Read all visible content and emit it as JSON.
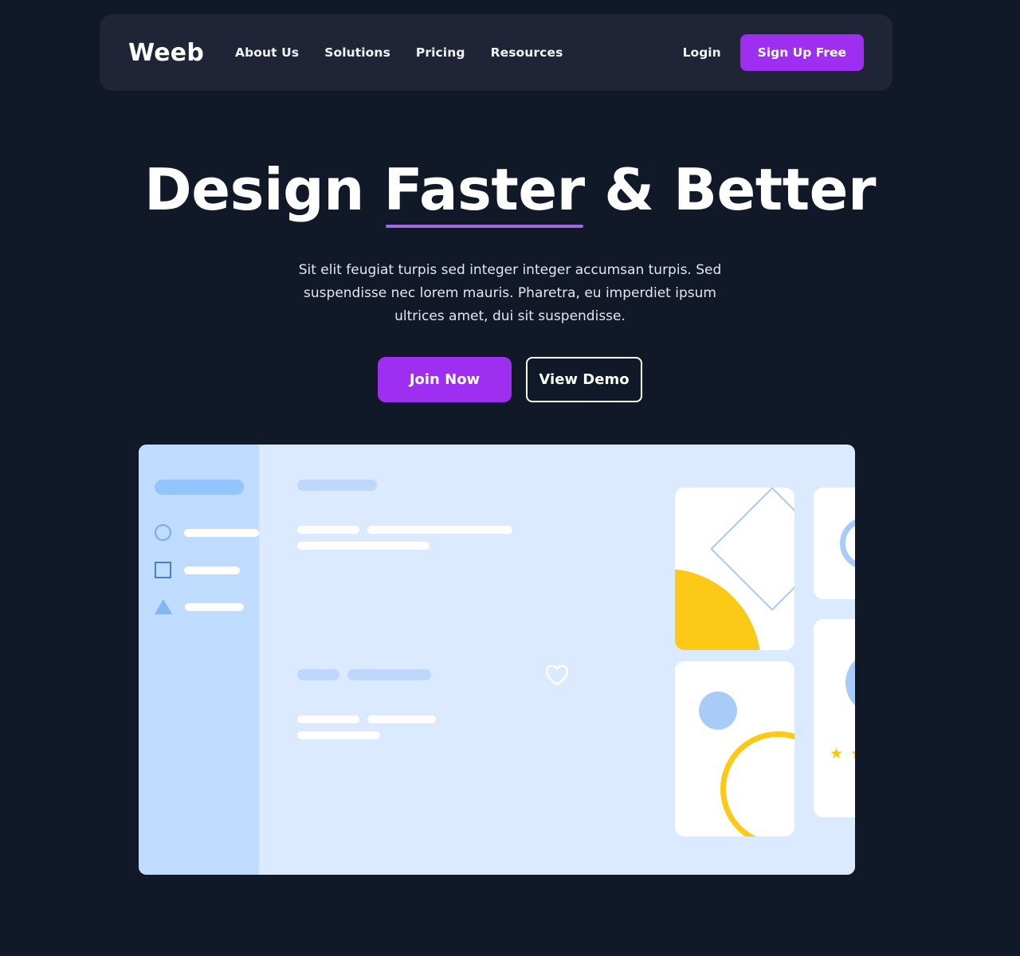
{
  "header": {
    "logo": "Weeb",
    "nav": [
      {
        "label": "About Us"
      },
      {
        "label": "Solutions"
      },
      {
        "label": "Pricing"
      },
      {
        "label": "Resources"
      }
    ],
    "login_label": "Login",
    "signup_label": "Sign Up Free"
  },
  "hero": {
    "title_part1": "Design ",
    "title_highlight": "Faster",
    "title_part2": " & Better",
    "subtitle": "Sit elit feugiat turpis sed integer integer accumsan turpis. Sed suspendisse nec lorem mauris. Pharetra, eu imperdiet ipsum ultrices amet, dui sit suspendisse.",
    "primary_cta": "Join Now",
    "secondary_cta": "View Demo"
  },
  "illustration": {
    "stars": [
      "★",
      "★",
      "★",
      "★",
      "★"
    ]
  },
  "colors": {
    "page_background": "#111827",
    "header_background": "#1f2437",
    "accent_purple": "#9e2ff0",
    "underline_purple": "#a06ae0",
    "illustration_panel": "#dbeafe",
    "illustration_sidebar": "#bfdbfe",
    "accent_yellow": "#fbc916",
    "accent_blue": "#a8cbf8",
    "text_white": "#ffffff"
  }
}
